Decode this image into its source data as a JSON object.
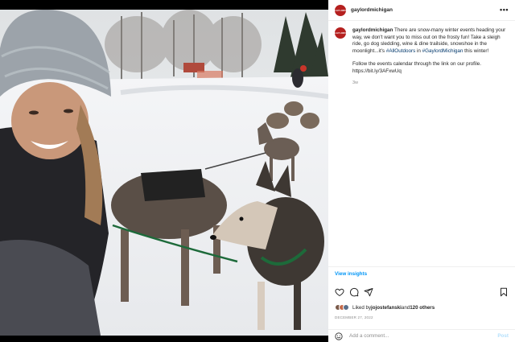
{
  "post": {
    "account": {
      "username": "gaylordmichigan",
      "avatar_text": "GAYLORD",
      "avatar_color": "#b5201f"
    },
    "more_label": "•••",
    "caption": {
      "text_part1": "There are snow-many winter events heading your way, we don't want you to miss out on the frosty fun! Take a sleigh ride, go dog sledding, wine & dine trailside, snowshoe in the moonlight...it's ",
      "hashtag1": "#AllOutdoors",
      "text_part2": " in ",
      "hashtag2": "#GaylordMichigan",
      "text_part3": " this winter!",
      "paragraph2": "Follow the events calendar through the link on our profile.",
      "link": "https://bit.ly/3AFxwUq"
    },
    "age": "3w",
    "insights_label": "View insights",
    "likes": {
      "prefix": "Liked by ",
      "user": "jojostefanski",
      "middle": " and ",
      "others": "120 others"
    },
    "date": "DECEMBER 27, 2022",
    "comment": {
      "placeholder": "Add a comment...",
      "post_label": "Post"
    },
    "icons": {
      "like": "heart-icon",
      "comment": "comment-icon",
      "share": "share-icon",
      "save": "bookmark-icon",
      "emoji": "emoji-icon"
    },
    "colors": {
      "link": "#00376b",
      "insights": "#0095f6",
      "post_disabled": "#b2dffc",
      "muted": "#8e8e8e"
    }
  }
}
